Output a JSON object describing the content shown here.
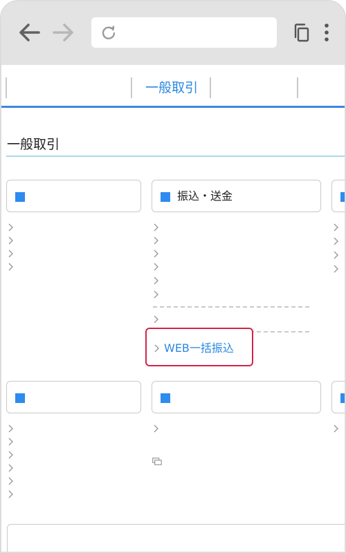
{
  "browser": {
    "icons": [
      "arrow-left-icon",
      "arrow-right-icon",
      "reload-icon",
      "tabs-icon",
      "more-vert-icon"
    ]
  },
  "topnav": {
    "active_label": "一般取引"
  },
  "section": {
    "title": "一般取引"
  },
  "cards": {
    "transfer": {
      "label": "振込・送金"
    }
  },
  "links": {
    "web_bulk_transfer": "WEB一括振込"
  },
  "colors": {
    "accent": "#2a88e2",
    "card_marker": "#2e8bef",
    "highlight_border": "#d2244a",
    "section_underline": "#a8d8ef"
  }
}
